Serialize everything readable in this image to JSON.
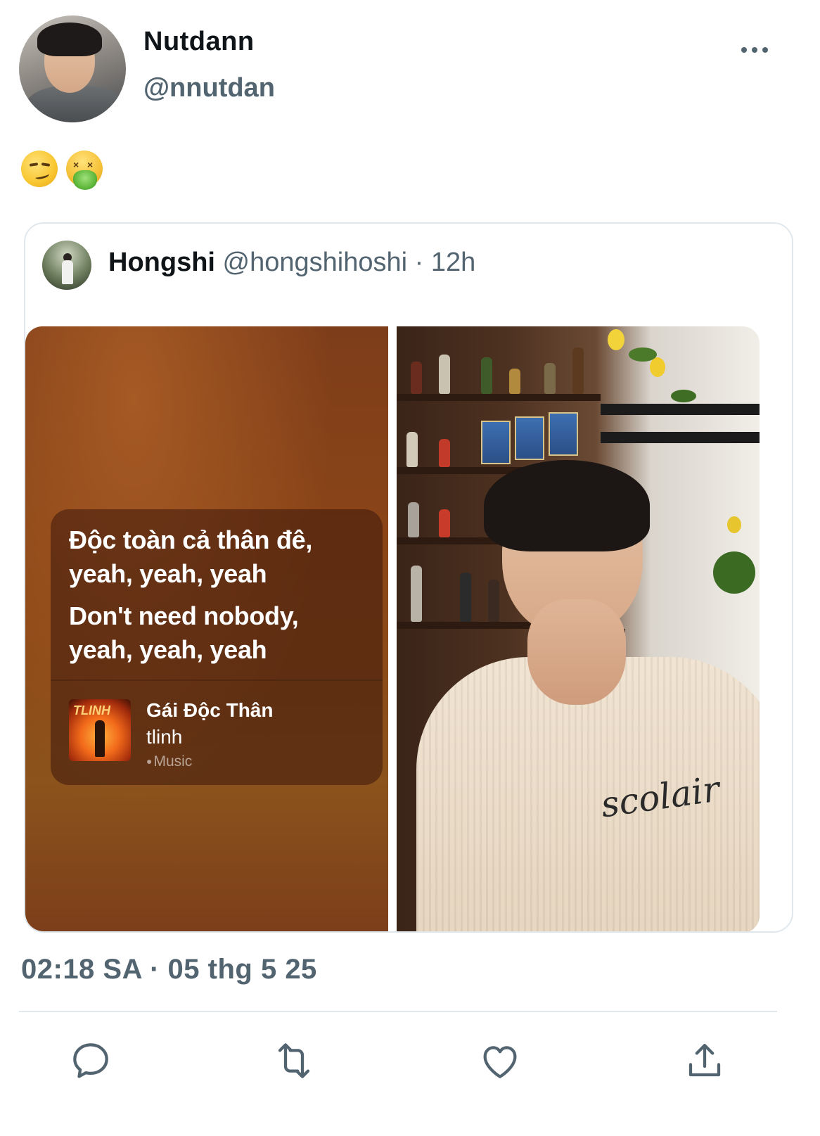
{
  "author": {
    "display_name": "Nutdann",
    "handle": "@nnutdan"
  },
  "tweet": {
    "emojis": [
      "smirking-face",
      "face-vomiting"
    ]
  },
  "quoted": {
    "display_name": "Hongshi",
    "handle": "@hongshihoshi",
    "separator": "·",
    "time": "12h",
    "lyrics": {
      "lines": [
        "Độc toàn cả thân đê,",
        "yeah, yeah, yeah",
        "Don't need nobody,",
        "yeah, yeah, yeah"
      ],
      "song_title": "Gái Độc Thân",
      "artist": "tlinh",
      "service": "Music",
      "album_art_text": "TLINH"
    },
    "photo_shirt_text": "scolair"
  },
  "timestamp": "02:18 SA · 05 thg 5 25",
  "actions": {
    "reply": "reply-icon",
    "retweet": "retweet-icon",
    "like": "like-icon",
    "share": "share-icon"
  },
  "colors": {
    "secondary_text": "#536471",
    "border": "#e1e8ed"
  }
}
